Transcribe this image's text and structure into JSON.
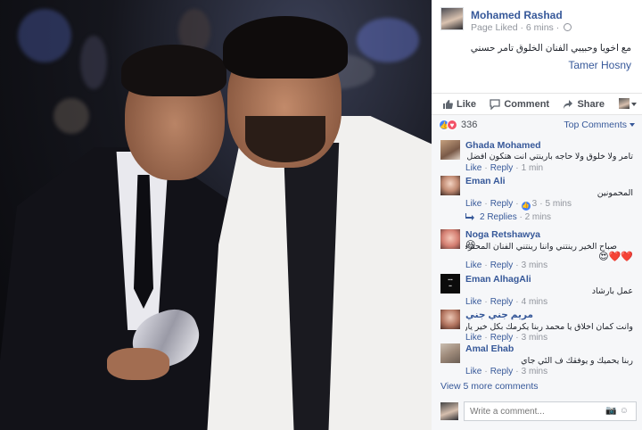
{
  "post": {
    "page_name": "Mohamed Rashad",
    "meta": "Page Liked · 6 mins ·",
    "caption": "مع اخويا وحبيبي الفنان الخلوق تامر حسني",
    "tagged": "Tamer Hosny"
  },
  "actions": {
    "like": "Like",
    "comment": "Comment",
    "share": "Share"
  },
  "reactions": {
    "count": "336",
    "sort_label": "Top Comments"
  },
  "comments": [
    {
      "name": "Ghada Mohamed",
      "text": "تامر ولا خلوق ولا حاجه بارينتي انت هتكون افضل بأخلاقك وشعبيتك",
      "like": "Like",
      "reply": "Reply",
      "time": "1 min"
    },
    {
      "name": "Eman Ali",
      "text": "المحمونين",
      "like": "Like",
      "reply": "Reply",
      "likes": "3",
      "time": "5 mins",
      "replies": "2 Replies",
      "replies_time": "2 mins"
    },
    {
      "name": "Noga Retshawya",
      "text": "صباح الخير رينتني واننا رينتني الفنان المحترم ربنا يوفقك يارب",
      "emoji_inline": "😆",
      "emoji_line": "😍❤️❤️",
      "like": "Like",
      "reply": "Reply",
      "time": "3 mins"
    },
    {
      "name": "Eman AlhagAli",
      "text": "عمل بارشاد",
      "like": "Like",
      "reply": "Reply",
      "time": "4 mins"
    },
    {
      "name": "مريم جني جني",
      "text": "وانت كمان اخلاق يا محمد ربنا يكرمك بكل خير يارب",
      "like": "Like",
      "reply": "Reply",
      "time": "3 mins"
    },
    {
      "name": "Amal Ehab",
      "text": "ربنا يحميك و يوفقك ف الئي جاي",
      "like": "Like",
      "reply": "Reply",
      "time": "3 mins"
    }
  ],
  "view_more": "View 5 more comments",
  "write_placeholder": "Write a comment..."
}
